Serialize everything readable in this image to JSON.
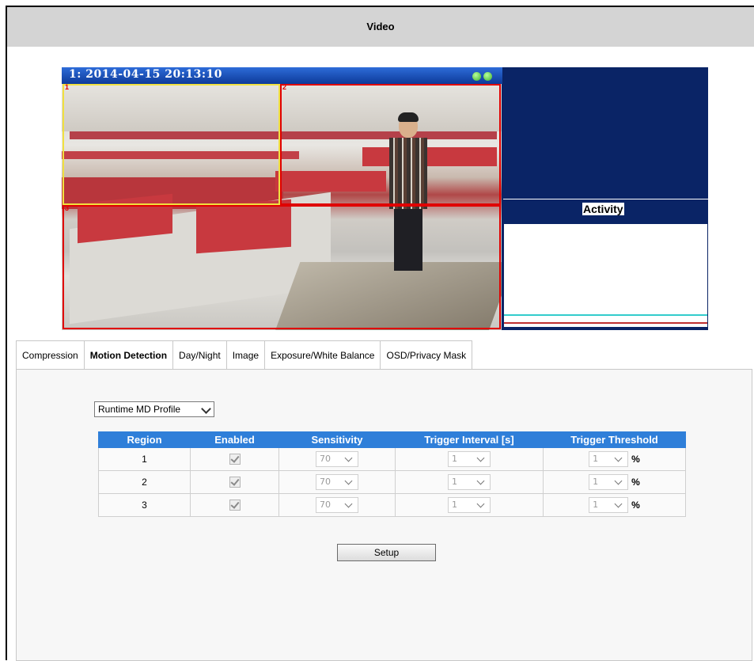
{
  "header": {
    "title": "Video"
  },
  "video": {
    "overlay_text": "1:  2014-04-15 20:13:10",
    "regions": [
      "1",
      "2",
      "3"
    ],
    "activity_label": "Activity"
  },
  "tabs": [
    {
      "label": "Compression",
      "active": false
    },
    {
      "label": "Motion Detection",
      "active": true
    },
    {
      "label": "Day/Night",
      "active": false
    },
    {
      "label": "Image",
      "active": false
    },
    {
      "label": "Exposure/White Balance",
      "active": false
    },
    {
      "label": "OSD/Privacy Mask",
      "active": false
    }
  ],
  "motion": {
    "profile_select": "Runtime MD Profile",
    "table": {
      "headers": [
        "Region",
        "Enabled",
        "Sensitivity",
        "Trigger Interval [s]",
        "Trigger Threshold"
      ],
      "rows": [
        {
          "region": "1",
          "enabled": true,
          "sensitivity": "70",
          "interval": "1",
          "threshold": "1",
          "unit": "%"
        },
        {
          "region": "2",
          "enabled": true,
          "sensitivity": "70",
          "interval": "1",
          "threshold": "1",
          "unit": "%"
        },
        {
          "region": "3",
          "enabled": true,
          "sensitivity": "70",
          "interval": "1",
          "threshold": "1",
          "unit": "%"
        }
      ]
    },
    "setup_label": "Setup"
  },
  "colors": {
    "header_bg": "#d4d4d4",
    "table_header": "#2f7fd9",
    "video_bg": "#0a2466",
    "region_1": "#f0e040",
    "region_2": "#e00000",
    "region_3": "#e00000"
  }
}
